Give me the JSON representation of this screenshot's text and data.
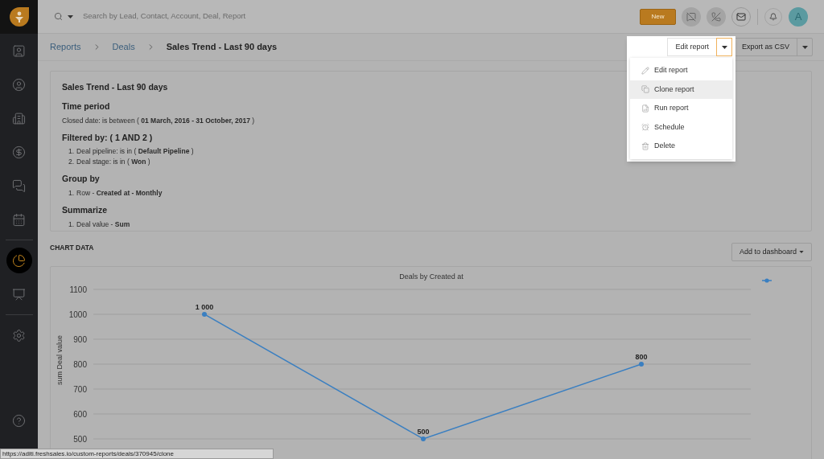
{
  "sidebar": {
    "groups": [
      [
        {
          "kind": "contacts",
          "selected": false
        },
        {
          "kind": "person",
          "selected": false
        },
        {
          "kind": "building",
          "selected": false
        },
        {
          "kind": "dollar",
          "selected": false
        },
        {
          "kind": "chat",
          "selected": false
        },
        {
          "kind": "calendar",
          "selected": false
        }
      ],
      [
        {
          "kind": "reports",
          "selected": true
        },
        {
          "kind": "presentation",
          "selected": false
        }
      ],
      [
        {
          "kind": "settings",
          "selected": false
        }
      ]
    ],
    "footer_items": [
      {
        "kind": "help",
        "selected": false
      }
    ]
  },
  "topbar": {
    "search": {
      "placeholder": "Search by Lead, Contact, Account, Deal, Report"
    },
    "new_button": "New",
    "avatar": "A"
  },
  "breadcrumb": {
    "links": [
      "Reports",
      "Deals"
    ],
    "current": "Sales Trend - Last 90 days"
  },
  "actions": {
    "edit_button": "Edit report",
    "edit_menu_open": true,
    "export_button": "Export as CSV"
  },
  "menu": [
    {
      "kind": "pencil",
      "label": "Edit report",
      "selected": false
    },
    {
      "kind": "clone",
      "label": "Clone report",
      "selected": true
    },
    {
      "kind": "run",
      "label": "Run report",
      "selected": false
    },
    {
      "kind": "clock",
      "label": "Schedule",
      "selected": false
    },
    {
      "kind": "trash",
      "label": "Delete",
      "selected": false
    }
  ],
  "report": {
    "title": "Sales Trend - Last 90 days",
    "sections": [
      {
        "heading": "Time period",
        "items": [
          {
            "text": "Closed date: is between ( **01 March, 2016 - 31 October, 2017** )"
          }
        ]
      },
      {
        "heading": "Filtered by: ( 1 AND 2 )",
        "items": [
          {
            "number": "1.",
            "text": "Deal pipeline: is in ( **Default Pipeline** )"
          },
          {
            "number": "2.",
            "text": "Deal stage: is in ( **Won** )"
          }
        ]
      },
      {
        "heading": "Group by",
        "items": [
          {
            "number": "1.",
            "text": "Row - **Created at - Monthly**"
          }
        ]
      },
      {
        "heading": "Summarize",
        "items": [
          {
            "number": "1.",
            "text": "Deal value - **Sum**"
          }
        ]
      }
    ]
  },
  "chart_section": {
    "label": "CHART DATA",
    "add_button": "Add to dashboard",
    "chart_data": {
      "type": "line",
      "title": "Deals by Created at",
      "ylabel": "sum Deal value",
      "ylim": [
        500,
        1100
      ],
      "yticks": [
        500,
        600,
        700,
        800,
        900,
        1000,
        1100
      ],
      "grid": true,
      "data_labels": true,
      "series": [
        {
          "color": "#3a7fc1",
          "marker": true,
          "values": [
            1000,
            500,
            800
          ],
          "value_labels": [
            "1 000",
            "500",
            "800"
          ]
        }
      ]
    }
  },
  "status_url": "https://aditi.freshsales.io/custom-reports/deals/370945/clone"
}
